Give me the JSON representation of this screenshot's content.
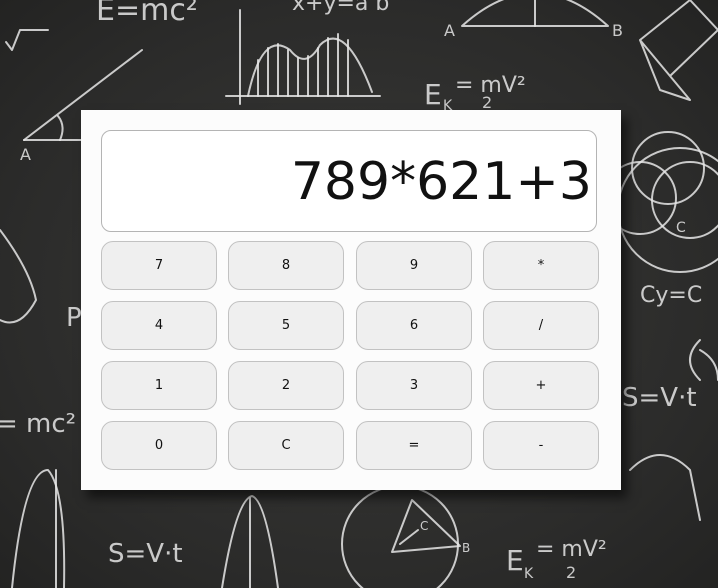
{
  "background": {
    "formulas": {
      "emc_top": "E=mc²",
      "xy_top": "x+y=a b",
      "ek_top": "E",
      "ek_top_sub": "K",
      "ek_top_eq": "= mV²",
      "ek_top_den": "2",
      "emc_left": "= mc²",
      "sv_right": "S=V·t",
      "sv_bottom": "S=V·t",
      "ek_bottom": "E",
      "ek_bottom_sub": "K",
      "ek_bottom_eq": "= mV²",
      "ek_bottom_den": "2",
      "cy_right": "Cy=C",
      "label_a_left": "A",
      "label_a_top": "A",
      "label_b_top": "B",
      "label_p": "P",
      "label_c_venn": "C",
      "label_b_bottom": "B",
      "label_c_bottom": "C"
    }
  },
  "calculator": {
    "display_value": "789*621+3",
    "keys": [
      {
        "label": "7"
      },
      {
        "label": "8"
      },
      {
        "label": "9"
      },
      {
        "label": "*"
      },
      {
        "label": "4"
      },
      {
        "label": "5"
      },
      {
        "label": "6"
      },
      {
        "label": "/"
      },
      {
        "label": "1"
      },
      {
        "label": "2"
      },
      {
        "label": "3"
      },
      {
        "label": "+"
      },
      {
        "label": "0"
      },
      {
        "label": "C"
      },
      {
        "label": "="
      },
      {
        "label": "-"
      }
    ]
  }
}
